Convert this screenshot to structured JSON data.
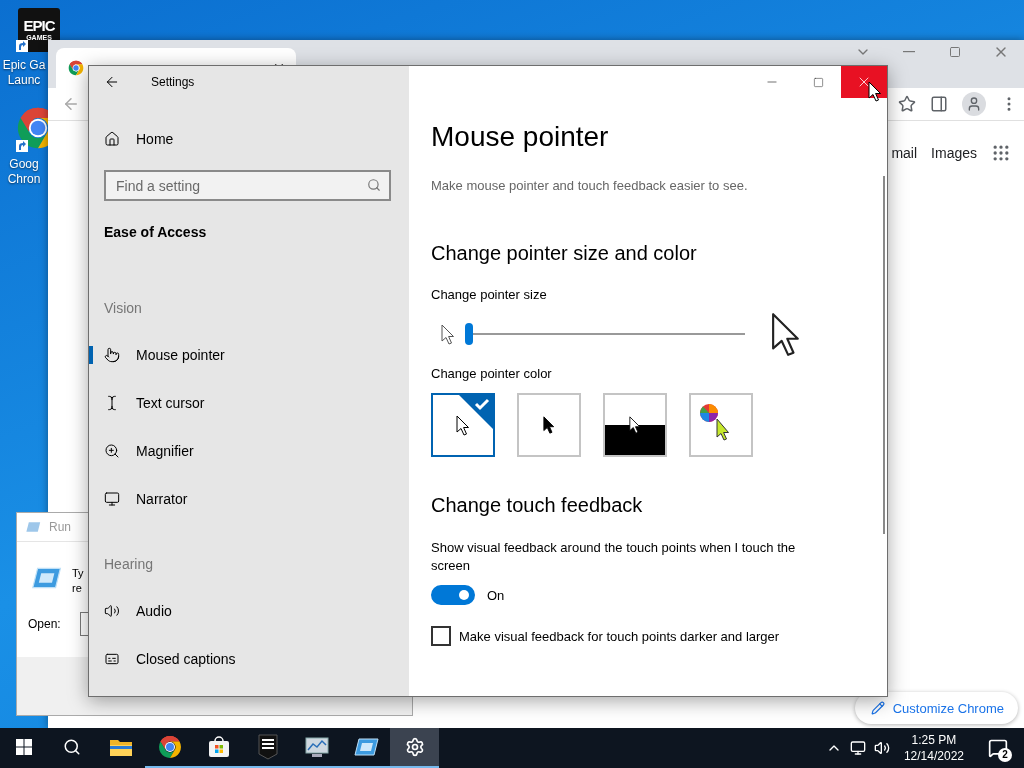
{
  "desktop_icons": [
    {
      "kind": "epic",
      "logo_text": [
        "EPIC",
        "GAMES"
      ],
      "label": [
        "Epic Ga",
        "Launc"
      ]
    },
    {
      "kind": "chrome",
      "label": [
        "Goog",
        "Chron"
      ]
    }
  ],
  "browser": {
    "links": [
      "mail",
      "Images"
    ],
    "customize_button": "Customize Chrome"
  },
  "run_dialog": {
    "title": "Run",
    "prompt": [
      "Ty",
      "re"
    ],
    "open_label": "Open:"
  },
  "settings": {
    "title": "Settings",
    "home": "Home",
    "search": {
      "placeholder": "Find a setting"
    },
    "category": "Ease of Access",
    "groups": [
      {
        "heading": "Vision",
        "items": [
          {
            "label": "Mouse pointer",
            "kind": "pointer",
            "selected": true
          },
          {
            "label": "Text cursor",
            "kind": "text-cursor",
            "selected": false
          },
          {
            "label": "Magnifier",
            "kind": "magnifier",
            "selected": false
          },
          {
            "label": "Narrator",
            "kind": "narrator",
            "selected": false
          }
        ]
      },
      {
        "heading": "Hearing",
        "items": [
          {
            "label": "Audio",
            "kind": "audio",
            "selected": false
          },
          {
            "label": "Closed captions",
            "kind": "captions",
            "selected": false
          }
        ]
      }
    ],
    "page": {
      "title": "Mouse pointer",
      "description": "Make mouse pointer and touch feedback easier to see.",
      "size_section": {
        "heading": "Change pointer size and color",
        "size_label": "Change pointer size",
        "size": {
          "level": 0
        },
        "color_label": "Change pointer color",
        "colors": [
          {
            "kind": "white",
            "selected": true
          },
          {
            "kind": "black",
            "selected": false
          },
          {
            "kind": "inverted",
            "selected": false
          },
          {
            "kind": "custom",
            "selected": false
          }
        ]
      },
      "touch_section": {
        "heading": "Change touch feedback",
        "toggle_label": "Show visual feedback around the touch points when I touch the screen",
        "toggle": {
          "on": true,
          "state_text": "On"
        },
        "checkbox": {
          "label": "Make visual feedback for touch points darker and larger",
          "checked": false
        }
      }
    }
  },
  "taskbar": {
    "apps": [
      {
        "kind": "explorer",
        "running": false,
        "active": false
      },
      {
        "kind": "chrome",
        "running": true,
        "active": false
      },
      {
        "kind": "store",
        "running": true,
        "active": false
      },
      {
        "kind": "epic",
        "running": true,
        "active": false
      },
      {
        "kind": "monitor",
        "running": true,
        "active": false
      },
      {
        "kind": "run",
        "running": true,
        "active": false
      },
      {
        "kind": "settings",
        "running": true,
        "active": true
      }
    ],
    "time": "1:25 PM",
    "date": "12/14/2022",
    "notifications": "2"
  }
}
